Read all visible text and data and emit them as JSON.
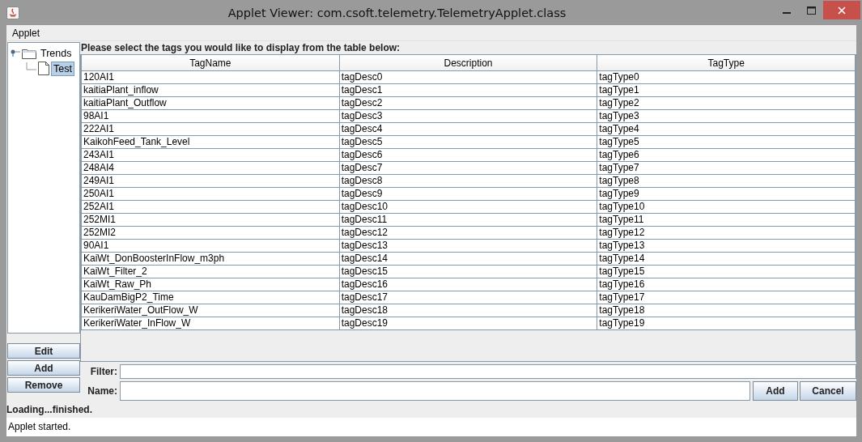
{
  "window": {
    "title": "Applet Viewer: com.csoft.telemetry.TelemetryApplet.class"
  },
  "menu": [
    "Applet"
  ],
  "tree": [
    {
      "label": "Trends",
      "kind": "folder",
      "expanded": true,
      "selected": false,
      "children": [
        {
          "label": "Test",
          "kind": "file",
          "selected": true
        }
      ]
    }
  ],
  "side_buttons": [
    "Edit",
    "Add",
    "Remove"
  ],
  "prompt": "Please select the tags you would like to display from the table below:",
  "table": {
    "columns": [
      "TagName",
      "Description",
      "TagType"
    ],
    "rows": [
      [
        "120AI1",
        "tagDesc0",
        "tagType0"
      ],
      [
        "kaitiaPlant_inflow",
        "tagDesc1",
        "tagType1"
      ],
      [
        "kaitiaPlant_Outflow",
        "tagDesc2",
        "tagType2"
      ],
      [
        "98AI1",
        "tagDesc3",
        "tagType3"
      ],
      [
        "222AI1",
        "tagDesc4",
        "tagType4"
      ],
      [
        "KaikohFeed_Tank_Level",
        "tagDesc5",
        "tagType5"
      ],
      [
        "243AI1",
        "tagDesc6",
        "tagType6"
      ],
      [
        "248AI4",
        "tagDesc7",
        "tagType7"
      ],
      [
        "249AI1",
        "tagDesc8",
        "tagType8"
      ],
      [
        "250AI1",
        "tagDesc9",
        "tagType9"
      ],
      [
        "252AI1",
        "tagDesc10",
        "tagType10"
      ],
      [
        "252MI1",
        "tagDesc11",
        "tagType11"
      ],
      [
        "252MI2",
        "tagDesc12",
        "tagType12"
      ],
      [
        "90AI1",
        "tagDesc13",
        "tagType13"
      ],
      [
        "KaiWt_DonBoosterInFlow_m3ph",
        "tagDesc14",
        "tagType14"
      ],
      [
        "KaiWt_Filter_2",
        "tagDesc15",
        "tagType15"
      ],
      [
        "KaiWt_Raw_Ph",
        "tagDesc16",
        "tagType16"
      ],
      [
        "KauDamBigP2_Time",
        "tagDesc17",
        "tagType17"
      ],
      [
        "KerikeriWater_OutFlow_W",
        "tagDesc18",
        "tagType18"
      ],
      [
        "KerikeriWater_InFlow_W",
        "tagDesc19",
        "tagType19"
      ]
    ]
  },
  "filter": {
    "label": "Filter:"
  },
  "name": {
    "label": "Name:"
  },
  "form_buttons": [
    "Add",
    "Cancel"
  ],
  "loading_text": "Loading...finished.",
  "status_bar": "Applet started."
}
